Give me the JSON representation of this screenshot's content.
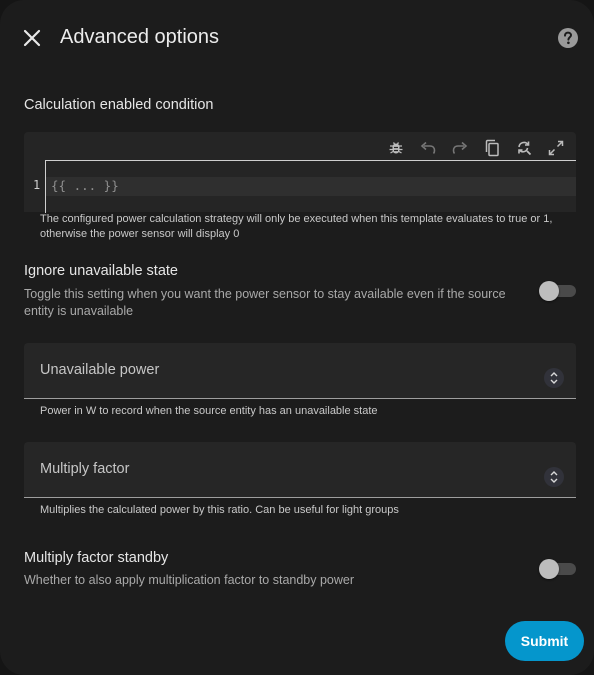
{
  "dialog": {
    "title": "Advanced options",
    "close_icon": "close-icon",
    "help_icon": "help-circle-icon"
  },
  "calculation": {
    "label": "Calculation enabled condition",
    "toolbar_icons": [
      "bug-icon",
      "undo-icon",
      "redo-icon",
      "copy-icon",
      "search-replace-icon",
      "fullscreen-icon"
    ],
    "line_number": "1",
    "code": "{{ ... }}",
    "helper": "The configured power calculation strategy will only be executed when this template evaluates to true or 1, otherwise the power sensor will display 0"
  },
  "ignore_unavailable": {
    "label": "Ignore unavailable state",
    "description": "Toggle this setting when you want the power sensor to stay available even if the source entity is unavailable",
    "checked": false
  },
  "unavailable_power": {
    "label": "Unavailable power",
    "helper": "Power in W to record when the source entity has an unavailable state"
  },
  "multiply_factor": {
    "label": "Multiply factor",
    "helper": "Multiplies the calculated power by this ratio. Can be useful for light groups"
  },
  "multiply_factor_standby": {
    "label": "Multiply factor standby",
    "description": "Whether to also apply multiplication factor to standby power",
    "checked": false
  },
  "actions": {
    "submit_label": "Submit"
  },
  "colors": {
    "accent": "#0596cc",
    "background": "#1c1c1c",
    "field": "#262626"
  }
}
